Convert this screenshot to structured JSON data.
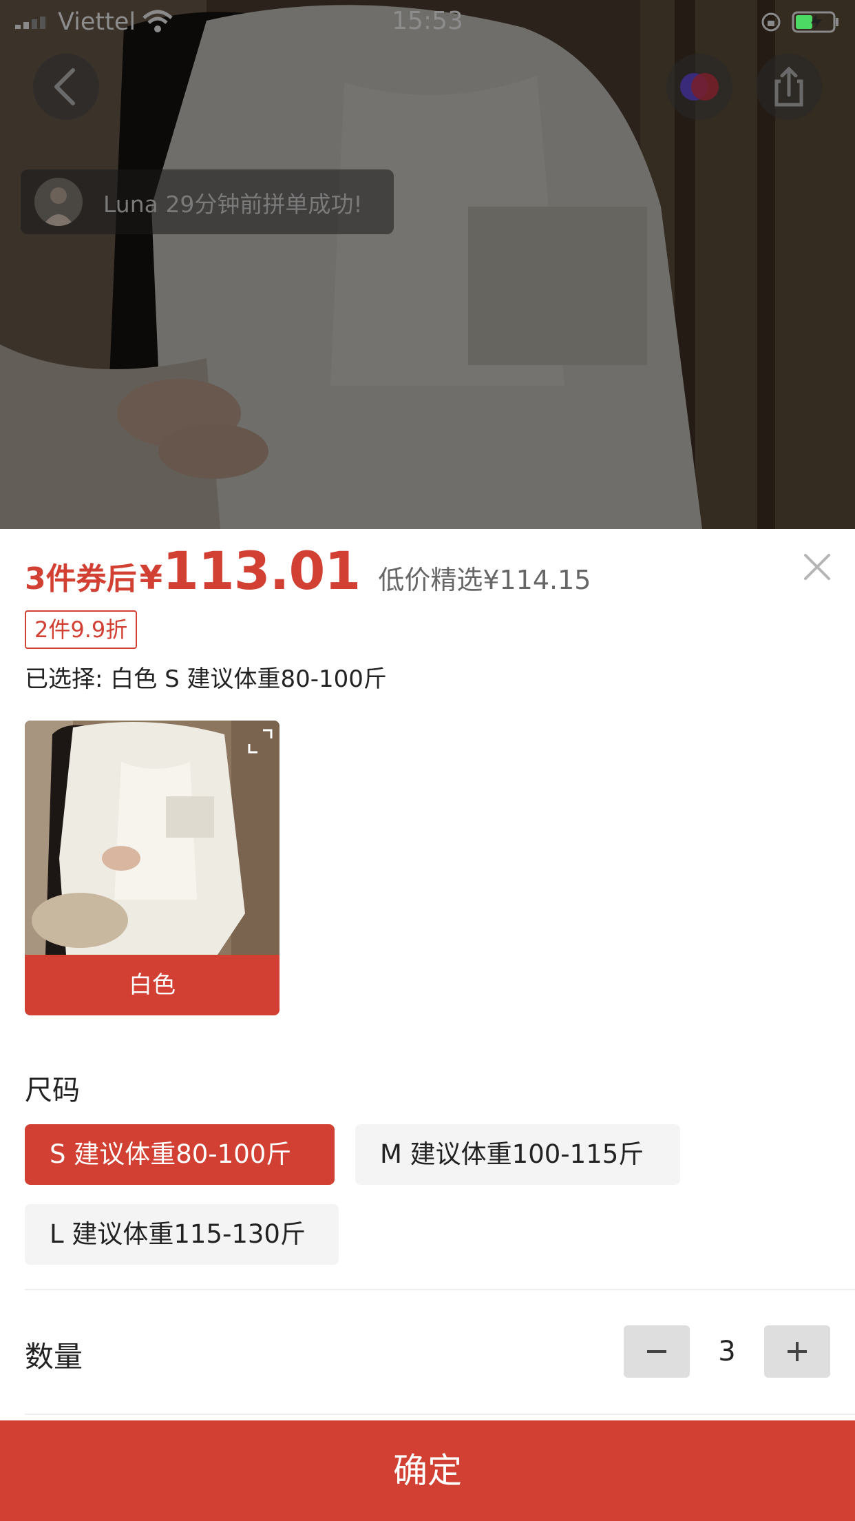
{
  "status_bar": {
    "carrier": "Viettel",
    "time": "15:53"
  },
  "toast": {
    "text": "Luna 29分钟前拼单成功!"
  },
  "price": {
    "prefix": "3件券后",
    "currency": "¥",
    "value": "113.01",
    "alt": "低价精选¥114.15"
  },
  "promo_tag": "2件9.9折",
  "selected_text": "已选择: 白色 S 建议体重80-100斤",
  "color_option": {
    "label": "白色"
  },
  "size": {
    "title": "尺码",
    "options": [
      {
        "label": "S 建议体重80-100斤",
        "selected": true
      },
      {
        "label": "M 建议体重100-115斤",
        "selected": false
      },
      {
        "label": "L 建议体重115-130斤",
        "selected": false
      }
    ]
  },
  "quantity": {
    "label": "数量",
    "value": "3"
  },
  "confirm_label": "确定",
  "colors": {
    "accent": "#d24033",
    "chip_bg": "#f4f4f4",
    "stepper_bg": "#dedede"
  }
}
